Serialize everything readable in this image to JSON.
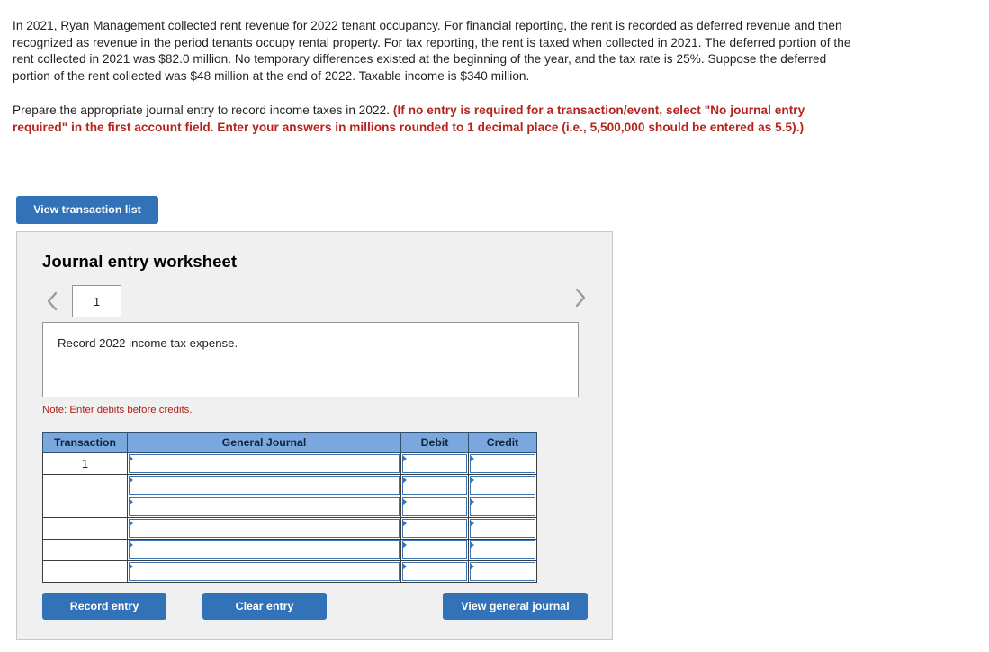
{
  "question": {
    "paragraph1": "In 2021, Ryan Management collected rent revenue for 2022 tenant occupancy. For financial reporting, the rent is recorded as deferred revenue and then recognized as revenue in the period tenants occupy rental property. For tax reporting, the rent is taxed when collected in 2021. The deferred portion of the rent collected in 2021 was $82.0 million. No temporary differences existed at the beginning of the year, and the tax rate is 25%. Suppose the deferred portion of the rent collected was $48 million at the end of 2022. Taxable income is $340 million.",
    "paragraph2_plain": "Prepare the appropriate journal entry to record income taxes in 2022. ",
    "paragraph2_bold": "(If no entry is required for a transaction/event, select \"No journal entry required\" in the first account field. Enter your answers in millions rounded to 1 decimal place (i.e., 5,500,000 should be entered as 5.5).)"
  },
  "toolbar": {
    "view_transaction_list_label": "View transaction list"
  },
  "worksheet": {
    "title": "Journal entry worksheet",
    "prev_icon": "chevron-left-icon",
    "next_icon": "chevron-right-icon",
    "tabs": [
      {
        "label": "1",
        "active": true
      }
    ],
    "description": "Record 2022 income tax expense.",
    "note": "Note: Enter debits before credits.",
    "table": {
      "headers": [
        "Transaction",
        "General Journal",
        "Debit",
        "Credit"
      ],
      "rows": [
        {
          "transaction": "1",
          "general_journal": "",
          "debit": "",
          "credit": ""
        },
        {
          "transaction": "",
          "general_journal": "",
          "debit": "",
          "credit": ""
        },
        {
          "transaction": "",
          "general_journal": "",
          "debit": "",
          "credit": ""
        },
        {
          "transaction": "",
          "general_journal": "",
          "debit": "",
          "credit": ""
        },
        {
          "transaction": "",
          "general_journal": "",
          "debit": "",
          "credit": ""
        },
        {
          "transaction": "",
          "general_journal": "",
          "debit": "",
          "credit": ""
        }
      ]
    },
    "buttons": {
      "record_entry_label": "Record entry",
      "clear_entry_label": "Clear entry",
      "view_general_journal_label": "View general journal"
    }
  },
  "colors": {
    "button_blue": "#3272b8",
    "table_header_blue": "#7aa8de",
    "note_red": "#b22019",
    "instruction_red": "#b5231c",
    "panel_grey": "#f0f0f0"
  }
}
